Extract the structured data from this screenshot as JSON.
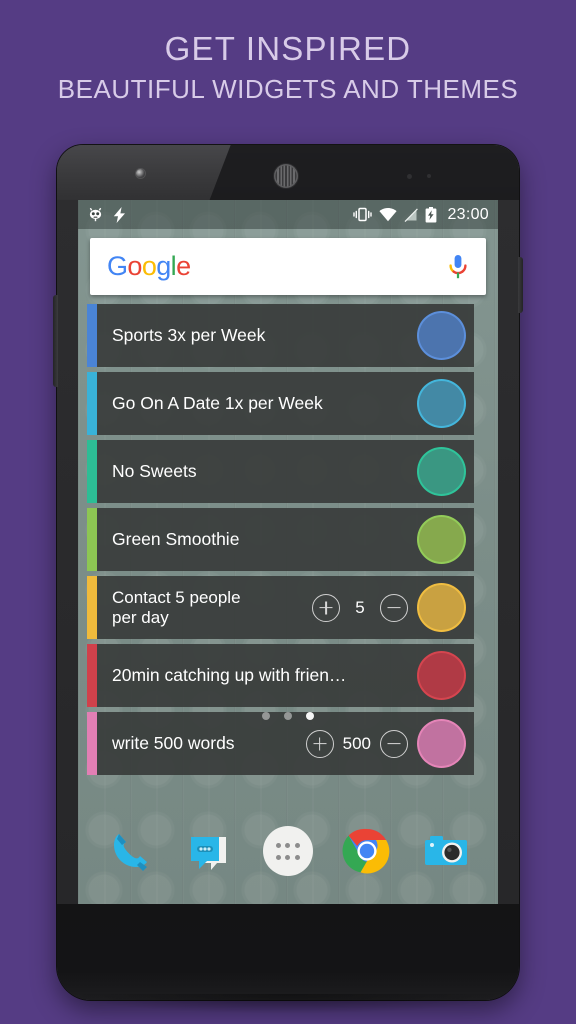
{
  "headline": {
    "line1": "GET INSPIRED",
    "line2": "BEAUTIFUL WIDGETS AND THEMES"
  },
  "colors": {
    "background": "#553C84",
    "headline_text": "#D8CBE8",
    "row_background": "#3A3D3C",
    "wallpaper": "#7D8F8A"
  },
  "statusbar": {
    "clock": "23:00",
    "left_icons": [
      "cyanogenmod-icon",
      "lightning-bolt-icon"
    ],
    "right_icons": [
      "vibrate-icon",
      "wifi-icon",
      "signal-icon",
      "battery-charging-icon"
    ]
  },
  "search": {
    "logo_letters": [
      {
        "ch": "G",
        "color": "#4285F4"
      },
      {
        "ch": "o",
        "color": "#EA4335"
      },
      {
        "ch": "o",
        "color": "#FBBC05"
      },
      {
        "ch": "g",
        "color": "#4285F4"
      },
      {
        "ch": "l",
        "color": "#34A853"
      },
      {
        "ch": "e",
        "color": "#EA4335"
      }
    ],
    "mic_label": "voice-search"
  },
  "widget": {
    "rows": [
      {
        "label": "Sports 3x per Week",
        "bar": "#4A84D6",
        "dot": "#4C74AE",
        "dot_border": "#5C8FDB",
        "counter": null
      },
      {
        "label": "Go On A Date 1x per Week",
        "bar": "#39B2D8",
        "dot": "#4389A5",
        "dot_border": "#44B6DC",
        "counter": null
      },
      {
        "label": "No Sweets",
        "bar": "#2DBD95",
        "dot": "#3A9782",
        "dot_border": "#2FC49A",
        "counter": null
      },
      {
        "label": "Green Smoothie",
        "bar": "#8DC653",
        "dot": "#86A94D",
        "dot_border": "#93CC59",
        "counter": null
      },
      {
        "label": "Contact 5 people\nper day",
        "bar": "#EFBA3C",
        "dot": "#C9A141",
        "dot_border": "#F0BD41",
        "counter": {
          "value": "5",
          "plus": "+",
          "minus": "−"
        }
      },
      {
        "label": "20min catching up with frien…",
        "bar": "#D0414B",
        "dot": "#B03A45",
        "dot_border": "#D5454F",
        "counter": null
      },
      {
        "label": "write 500 words",
        "bar": "#E27FB4",
        "dot": "#C172A0",
        "dot_border": "#E585B8",
        "counter": {
          "value": "500",
          "plus": "+",
          "minus": "−"
        }
      }
    ]
  },
  "pages": {
    "count": 3,
    "active_index": 2
  },
  "dock": {
    "apps": [
      {
        "name": "phone-icon",
        "label": "Phone"
      },
      {
        "name": "messages-icon",
        "label": "Messages"
      },
      {
        "name": "app-drawer-icon",
        "label": "Apps"
      },
      {
        "name": "chrome-icon",
        "label": "Chrome"
      },
      {
        "name": "camera-icon",
        "label": "Camera"
      }
    ]
  }
}
